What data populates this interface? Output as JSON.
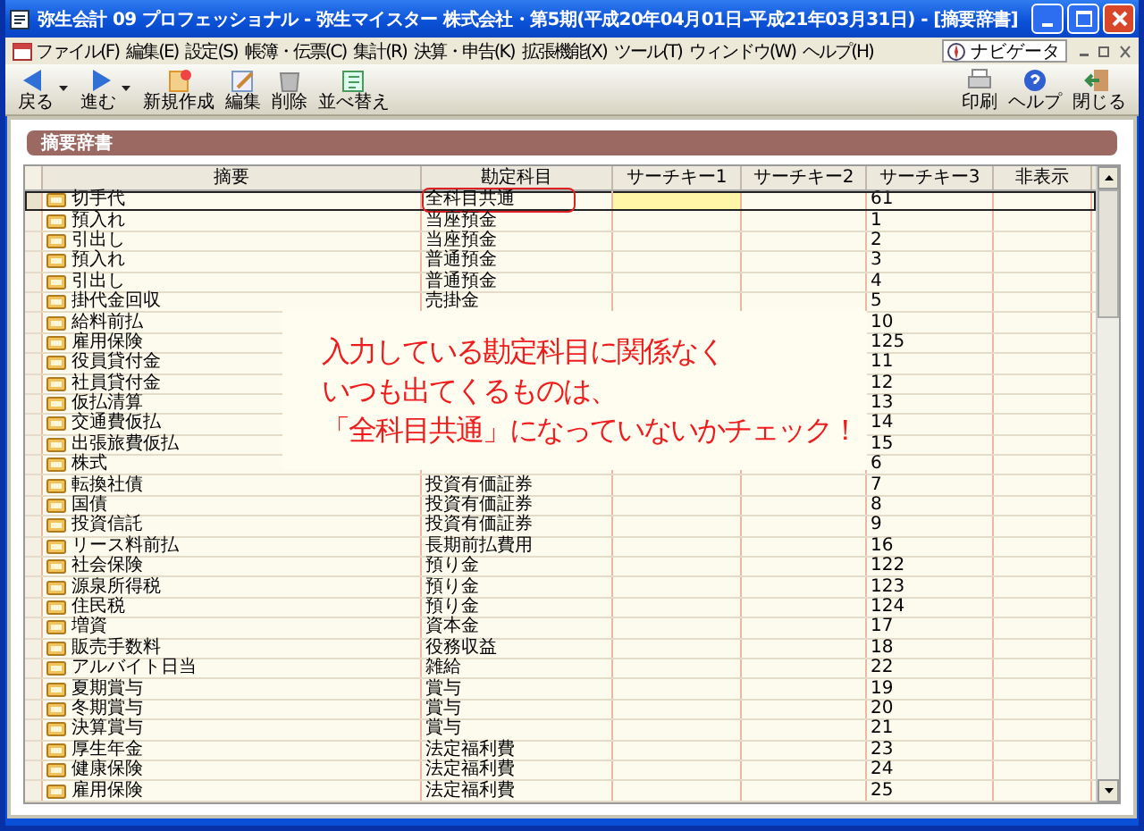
{
  "window": {
    "title": "弥生会計 09 プロフェッショナル - 弥生マイスター 株式会社・第5期(平成20年04月01日-平成21年03月31日) - [摘要辞書]"
  },
  "menu": [
    "ファイル(F)",
    "編集(E)",
    "設定(S)",
    "帳簿・伝票(C)",
    "集計(R)",
    "決算・申告(K)",
    "拡張機能(X)",
    "ツール(T)",
    "ウィンドウ(W)",
    "ヘルプ(H)"
  ],
  "navigator": "ナビゲータ",
  "toolbar_left": [
    {
      "label": "戻る",
      "kind": "back"
    },
    {
      "label": "進む",
      "kind": "forward"
    },
    {
      "label": "新規作成",
      "kind": "new"
    },
    {
      "label": "編集",
      "kind": "edit"
    },
    {
      "label": "削除",
      "kind": "delete"
    },
    {
      "label": "並べ替え",
      "kind": "sort"
    }
  ],
  "toolbar_right": [
    {
      "label": "印刷",
      "kind": "print"
    },
    {
      "label": "ヘルプ",
      "kind": "help"
    },
    {
      "label": "閉じる",
      "kind": "close"
    }
  ],
  "panel_title": "摘要辞書",
  "table": {
    "columns": [
      "摘要",
      "勘定科目",
      "サーチキー1",
      "サーチキー2",
      "サーチキー3",
      "非表示"
    ],
    "rows": [
      {
        "summary": "切手代",
        "account": "全科目共通",
        "key3": "61",
        "selected": true,
        "circled": true
      },
      {
        "summary": "預入れ",
        "account": "当座預金",
        "key3": "1",
        "selected": false,
        "circled": false
      },
      {
        "summary": "引出し",
        "account": "当座預金",
        "key3": "2",
        "selected": false,
        "circled": false
      },
      {
        "summary": "預入れ",
        "account": "普通預金",
        "key3": "3",
        "selected": false,
        "circled": false
      },
      {
        "summary": "引出し",
        "account": "普通預金",
        "key3": "4",
        "selected": false,
        "circled": false
      },
      {
        "summary": "掛代金回収",
        "account": "売掛金",
        "key3": "5",
        "selected": false,
        "circled": false
      },
      {
        "summary": "給料前払",
        "key3": "10",
        "selected": false,
        "circled": false
      },
      {
        "summary": "雇用保険",
        "key3": "125",
        "selected": false,
        "circled": false
      },
      {
        "summary": "役員貸付金",
        "key3": "11",
        "selected": false,
        "circled": false
      },
      {
        "summary": "社員貸付金",
        "key3": "12",
        "selected": false,
        "circled": false
      },
      {
        "summary": "仮払清算",
        "key3": "13",
        "selected": false,
        "circled": false
      },
      {
        "summary": "交通費仮払",
        "key3": "14",
        "selected": false,
        "circled": false
      },
      {
        "summary": "出張旅費仮払",
        "key3": "15",
        "selected": false,
        "circled": false
      },
      {
        "summary": "株式",
        "key3": "6",
        "selected": false,
        "circled": false
      },
      {
        "summary": "転換社債",
        "account": "投資有価証券",
        "key3": "7",
        "selected": false,
        "circled": false
      },
      {
        "summary": "国債",
        "account": "投資有価証券",
        "key3": "8",
        "selected": false,
        "circled": false
      },
      {
        "summary": "投資信託",
        "account": "投資有価証券",
        "key3": "9",
        "selected": false,
        "circled": false
      },
      {
        "summary": "リース料前払",
        "account": "長期前払費用",
        "key3": "16",
        "selected": false,
        "circled": false
      },
      {
        "summary": "社会保険",
        "account": "預り金",
        "key3": "122",
        "selected": false,
        "circled": false
      },
      {
        "summary": "源泉所得税",
        "account": "預り金",
        "key3": "123",
        "selected": false,
        "circled": false
      },
      {
        "summary": "住民税",
        "account": "預り金",
        "key3": "124",
        "selected": false,
        "circled": false
      },
      {
        "summary": "増資",
        "account": "資本金",
        "key3": "17",
        "selected": false,
        "circled": false
      },
      {
        "summary": "販売手数料",
        "account": "役務収益",
        "key3": "18",
        "selected": false,
        "circled": false
      },
      {
        "summary": "アルバイト日当",
        "account": "雑給",
        "key3": "22",
        "selected": false,
        "circled": false
      },
      {
        "summary": "夏期賞与",
        "account": "賞与",
        "key3": "19",
        "selected": false,
        "circled": false
      },
      {
        "summary": "冬期賞与",
        "account": "賞与",
        "key3": "20",
        "selected": false,
        "circled": false
      },
      {
        "summary": "決算賞与",
        "account": "賞与",
        "key3": "21",
        "selected": false,
        "circled": false
      },
      {
        "summary": "厚生年金",
        "account": "法定福利費",
        "key3": "23",
        "selected": false,
        "circled": false
      },
      {
        "summary": "健康保険",
        "account": "法定福利費",
        "key3": "24",
        "selected": false,
        "circled": false
      },
      {
        "summary": "雇用保険",
        "account": "法定福利費",
        "key3": "25",
        "selected": false,
        "circled": false
      }
    ]
  },
  "callout": [
    "入力している勘定科目に関係なく",
    "いつも出てくるものは、",
    "「全科目共通」になっていないかチェック！"
  ]
}
